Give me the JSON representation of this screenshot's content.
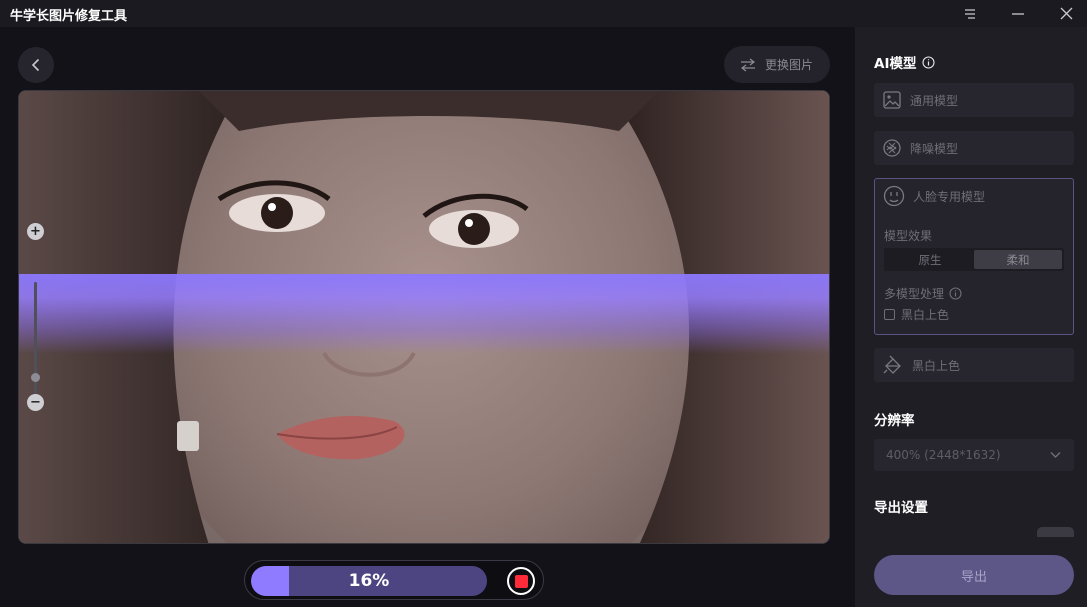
{
  "app": {
    "title": "牛学长图片修复工具"
  },
  "window_controls": [
    "menu-icon",
    "minimize-icon",
    "close-icon"
  ],
  "toolbar": {
    "back_icon": "chevron-left-icon",
    "replace_label": "更换图片",
    "replace_icon": "swap-arrows-icon"
  },
  "canvas": {
    "zoom_in": "+",
    "zoom_out": "−",
    "zoom_level_fraction": 0.24
  },
  "progress": {
    "value": 0.16,
    "text": "16%",
    "stop_icon": "stop-icon"
  },
  "sidebar": {
    "ai_model_title": "AI模型",
    "models": [
      {
        "label": "通用模型",
        "icon": "image-icon"
      },
      {
        "label": "降噪模型",
        "icon": "noise-icon"
      },
      {
        "label": "人脸专用模型",
        "icon": "face-icon"
      },
      {
        "label": "黑白上色",
        "icon": "paint-bucket-icon"
      }
    ],
    "face_options": {
      "effect_label": "模型效果",
      "effect_options": [
        "原生",
        "柔和"
      ],
      "effect_selected": "柔和",
      "multi_label": "多模型处理",
      "multi_checkbox_label": "黑白上色",
      "multi_checked": false
    },
    "resolution_title": "分辨率",
    "resolution_value": "400% (2448*1632)",
    "export_title": "导出设置",
    "export_button": "导出"
  },
  "colors": {
    "accent": "#8f7bff",
    "stop": "#ff2b3a",
    "sidebar_bg": "#1f1e25",
    "main_bg": "#131218"
  }
}
